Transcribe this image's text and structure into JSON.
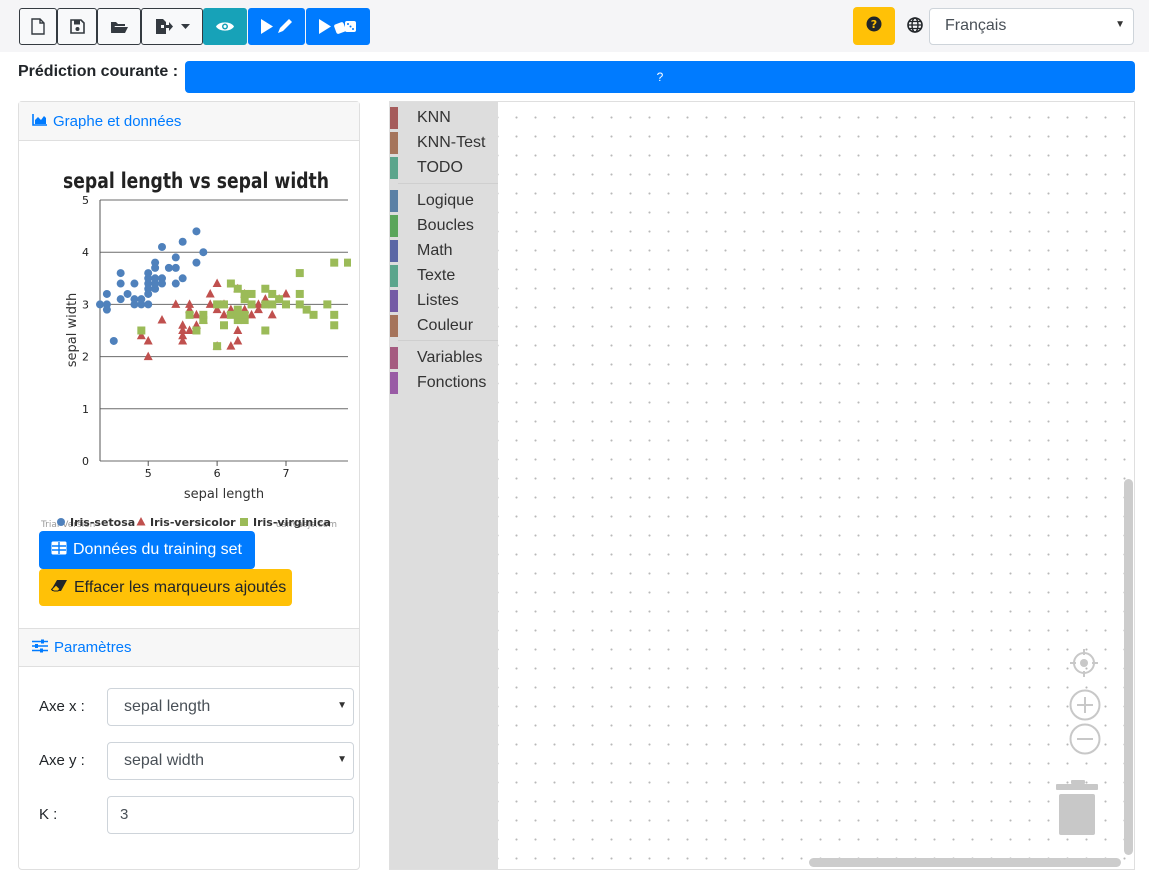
{
  "toolbar": {
    "new_icon": "file-icon",
    "save_icon": "save-icon",
    "open_icon": "folder-open-icon",
    "export_icon": "export-icon",
    "view_icon": "eye-icon",
    "run_edit_icon": "play-edit-icon",
    "run_random_icon": "play-dice-icon",
    "help_icon": "question-circle-icon",
    "language_icon": "globe-icon",
    "language_value": "Français"
  },
  "prediction": {
    "label": "Prédiction courante :",
    "value": "?"
  },
  "graph_panel": {
    "header": "Graphe et données",
    "training_button": "Données du training set",
    "clear_button": "Effacer les marqueurs ajoutés"
  },
  "chart_data": {
    "type": "scatter",
    "title": "sepal length vs sepal width",
    "xlabel": "sepal length",
    "ylabel": "sepal width",
    "xlim": [
      4.3,
      7.9
    ],
    "ylim": [
      0,
      5
    ],
    "xticks": [
      5,
      6,
      7
    ],
    "yticks": [
      0,
      1,
      2,
      3,
      4,
      5
    ],
    "grid": true,
    "legend_position": "bottom",
    "watermark_left": "Trial Version",
    "watermark_right": "canvasjs.com",
    "series": [
      {
        "name": "Iris-setosa",
        "marker": "circle",
        "color": "#4f81bc",
        "points": [
          [
            4.3,
            3.0
          ],
          [
            4.4,
            3.0
          ],
          [
            4.4,
            2.9
          ],
          [
            4.4,
            3.2
          ],
          [
            4.5,
            2.3
          ],
          [
            4.6,
            3.1
          ],
          [
            4.6,
            3.4
          ],
          [
            4.6,
            3.6
          ],
          [
            4.7,
            3.2
          ],
          [
            4.8,
            3.4
          ],
          [
            4.8,
            3.0
          ],
          [
            4.8,
            3.1
          ],
          [
            4.9,
            3.0
          ],
          [
            4.9,
            3.1
          ],
          [
            5.0,
            3.6
          ],
          [
            5.0,
            3.4
          ],
          [
            5.0,
            3.0
          ],
          [
            5.0,
            3.3
          ],
          [
            5.0,
            3.5
          ],
          [
            5.0,
            3.2
          ],
          [
            5.1,
            3.5
          ],
          [
            5.1,
            3.8
          ],
          [
            5.1,
            3.7
          ],
          [
            5.1,
            3.3
          ],
          [
            5.1,
            3.4
          ],
          [
            5.2,
            3.5
          ],
          [
            5.2,
            3.4
          ],
          [
            5.2,
            4.1
          ],
          [
            5.3,
            3.7
          ],
          [
            5.4,
            3.9
          ],
          [
            5.4,
            3.7
          ],
          [
            5.4,
            3.4
          ],
          [
            5.5,
            4.2
          ],
          [
            5.5,
            3.5
          ],
          [
            5.7,
            4.4
          ],
          [
            5.7,
            3.8
          ],
          [
            5.8,
            4.0
          ]
        ]
      },
      {
        "name": "Iris-versicolor",
        "marker": "triangle",
        "color": "#c0504e",
        "points": [
          [
            4.9,
            2.4
          ],
          [
            5.0,
            2.0
          ],
          [
            5.0,
            2.3
          ],
          [
            5.2,
            2.7
          ],
          [
            5.4,
            3.0
          ],
          [
            5.5,
            2.3
          ],
          [
            5.5,
            2.4
          ],
          [
            5.5,
            2.5
          ],
          [
            5.5,
            2.6
          ],
          [
            5.6,
            2.9
          ],
          [
            5.6,
            3.0
          ],
          [
            5.6,
            2.5
          ],
          [
            5.7,
            2.8
          ],
          [
            5.7,
            2.6
          ],
          [
            5.8,
            2.7
          ],
          [
            5.9,
            3.0
          ],
          [
            5.9,
            3.2
          ],
          [
            6.0,
            2.2
          ],
          [
            6.0,
            3.4
          ],
          [
            6.0,
            2.9
          ],
          [
            6.1,
            2.8
          ],
          [
            6.1,
            3.0
          ],
          [
            6.2,
            2.2
          ],
          [
            6.2,
            2.9
          ],
          [
            6.3,
            3.3
          ],
          [
            6.3,
            2.5
          ],
          [
            6.3,
            2.3
          ],
          [
            6.4,
            3.2
          ],
          [
            6.4,
            2.9
          ],
          [
            6.5,
            2.8
          ],
          [
            6.6,
            2.9
          ],
          [
            6.6,
            3.0
          ],
          [
            6.7,
            3.1
          ],
          [
            6.7,
            3.0
          ],
          [
            6.8,
            2.8
          ],
          [
            6.9,
            3.1
          ],
          [
            7.0,
            3.2
          ]
        ]
      },
      {
        "name": "Iris-virginica",
        "marker": "square",
        "color": "#9bbb58",
        "points": [
          [
            4.9,
            2.5
          ],
          [
            5.6,
            2.8
          ],
          [
            5.7,
            2.5
          ],
          [
            5.8,
            2.7
          ],
          [
            5.8,
            2.8
          ],
          [
            6.0,
            2.2
          ],
          [
            6.0,
            3.0
          ],
          [
            6.1,
            3.0
          ],
          [
            6.1,
            2.6
          ],
          [
            6.2,
            2.8
          ],
          [
            6.2,
            3.4
          ],
          [
            6.3,
            2.7
          ],
          [
            6.3,
            2.8
          ],
          [
            6.3,
            2.9
          ],
          [
            6.3,
            3.3
          ],
          [
            6.4,
            2.7
          ],
          [
            6.4,
            2.8
          ],
          [
            6.4,
            3.1
          ],
          [
            6.4,
            3.2
          ],
          [
            6.5,
            3.0
          ],
          [
            6.5,
            3.2
          ],
          [
            6.7,
            2.5
          ],
          [
            6.7,
            3.0
          ],
          [
            6.7,
            3.3
          ],
          [
            6.8,
            3.0
          ],
          [
            6.8,
            3.2
          ],
          [
            6.9,
            3.1
          ],
          [
            7.0,
            3.0
          ],
          [
            7.2,
            3.6
          ],
          [
            7.2,
            3.0
          ],
          [
            7.2,
            3.2
          ],
          [
            7.3,
            2.9
          ],
          [
            7.4,
            2.8
          ],
          [
            7.6,
            3.0
          ],
          [
            7.7,
            2.8
          ],
          [
            7.7,
            2.6
          ],
          [
            7.7,
            3.8
          ],
          [
            7.9,
            3.8
          ]
        ]
      }
    ]
  },
  "params_panel": {
    "header": "Paramètres",
    "axis_x_label": "Axe x :",
    "axis_x_value": "sepal length",
    "axis_y_label": "Axe y :",
    "axis_y_value": "sepal width",
    "k_label": "K :",
    "k_value": "3"
  },
  "toolbox": {
    "groups": [
      [
        {
          "label": "KNN",
          "color": "#a55b5b"
        },
        {
          "label": "KNN-Test",
          "color": "#a5745b"
        },
        {
          "label": "TODO",
          "color": "#5ba58c"
        }
      ],
      [
        {
          "label": "Logique",
          "color": "#5b80a5"
        },
        {
          "label": "Boucles",
          "color": "#5ba55b"
        },
        {
          "label": "Math",
          "color": "#5b67a5"
        },
        {
          "label": "Texte",
          "color": "#5ba58c"
        },
        {
          "label": "Listes",
          "color": "#745ba5"
        },
        {
          "label": "Couleur",
          "color": "#a5745b"
        }
      ],
      [
        {
          "label": "Variables",
          "color": "#a55b80"
        },
        {
          "label": "Fonctions",
          "color": "#995ba5"
        }
      ]
    ]
  },
  "workspace_controls": {
    "recenter_icon": "recenter-icon",
    "zoom_in_icon": "zoom-in-icon",
    "zoom_out_icon": "zoom-out-icon",
    "trash_icon": "trash-icon"
  },
  "colors": {
    "primary": "#007bff",
    "warning": "#ffc107",
    "info": "#17a2b8"
  }
}
